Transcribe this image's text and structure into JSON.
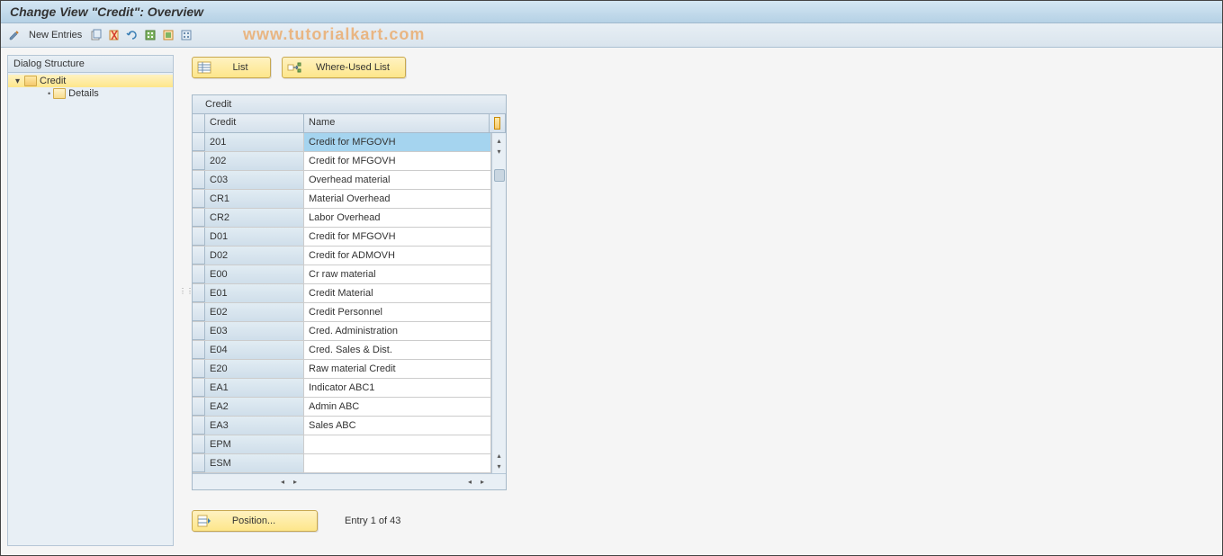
{
  "title": "Change View \"Credit\": Overview",
  "watermark": "www.tutorialkart.com",
  "toolbar": {
    "new_entries": "New Entries"
  },
  "dialog": {
    "header": "Dialog Structure",
    "root": "Credit",
    "child": "Details"
  },
  "actions": {
    "list": "List",
    "where_used": "Where-Used List"
  },
  "table": {
    "title": "Credit",
    "col_credit": "Credit",
    "col_name": "Name",
    "rows": [
      {
        "credit": "201",
        "name": "Credit for MFGOVH",
        "selected": true
      },
      {
        "credit": "202",
        "name": "Credit for MFGOVH"
      },
      {
        "credit": "C03",
        "name": "Overhead material"
      },
      {
        "credit": "CR1",
        "name": "Material Overhead"
      },
      {
        "credit": "CR2",
        "name": "Labor Overhead"
      },
      {
        "credit": "D01",
        "name": "Credit for MFGOVH"
      },
      {
        "credit": "D02",
        "name": "Credit for ADMOVH"
      },
      {
        "credit": "E00",
        "name": "Cr raw material"
      },
      {
        "credit": "E01",
        "name": "Credit Material"
      },
      {
        "credit": "E02",
        "name": "Credit Personnel"
      },
      {
        "credit": "E03",
        "name": "Cred. Administration"
      },
      {
        "credit": "E04",
        "name": "Cred. Sales & Dist."
      },
      {
        "credit": "E20",
        "name": "Raw material Credit"
      },
      {
        "credit": "EA1",
        "name": "Indicator ABC1"
      },
      {
        "credit": "EA2",
        "name": "Admin ABC"
      },
      {
        "credit": "EA3",
        "name": "Sales ABC"
      },
      {
        "credit": "EPM",
        "name": ""
      },
      {
        "credit": "ESM",
        "name": ""
      }
    ]
  },
  "footer": {
    "position": "Position...",
    "entry_text": "Entry 1 of 43"
  }
}
